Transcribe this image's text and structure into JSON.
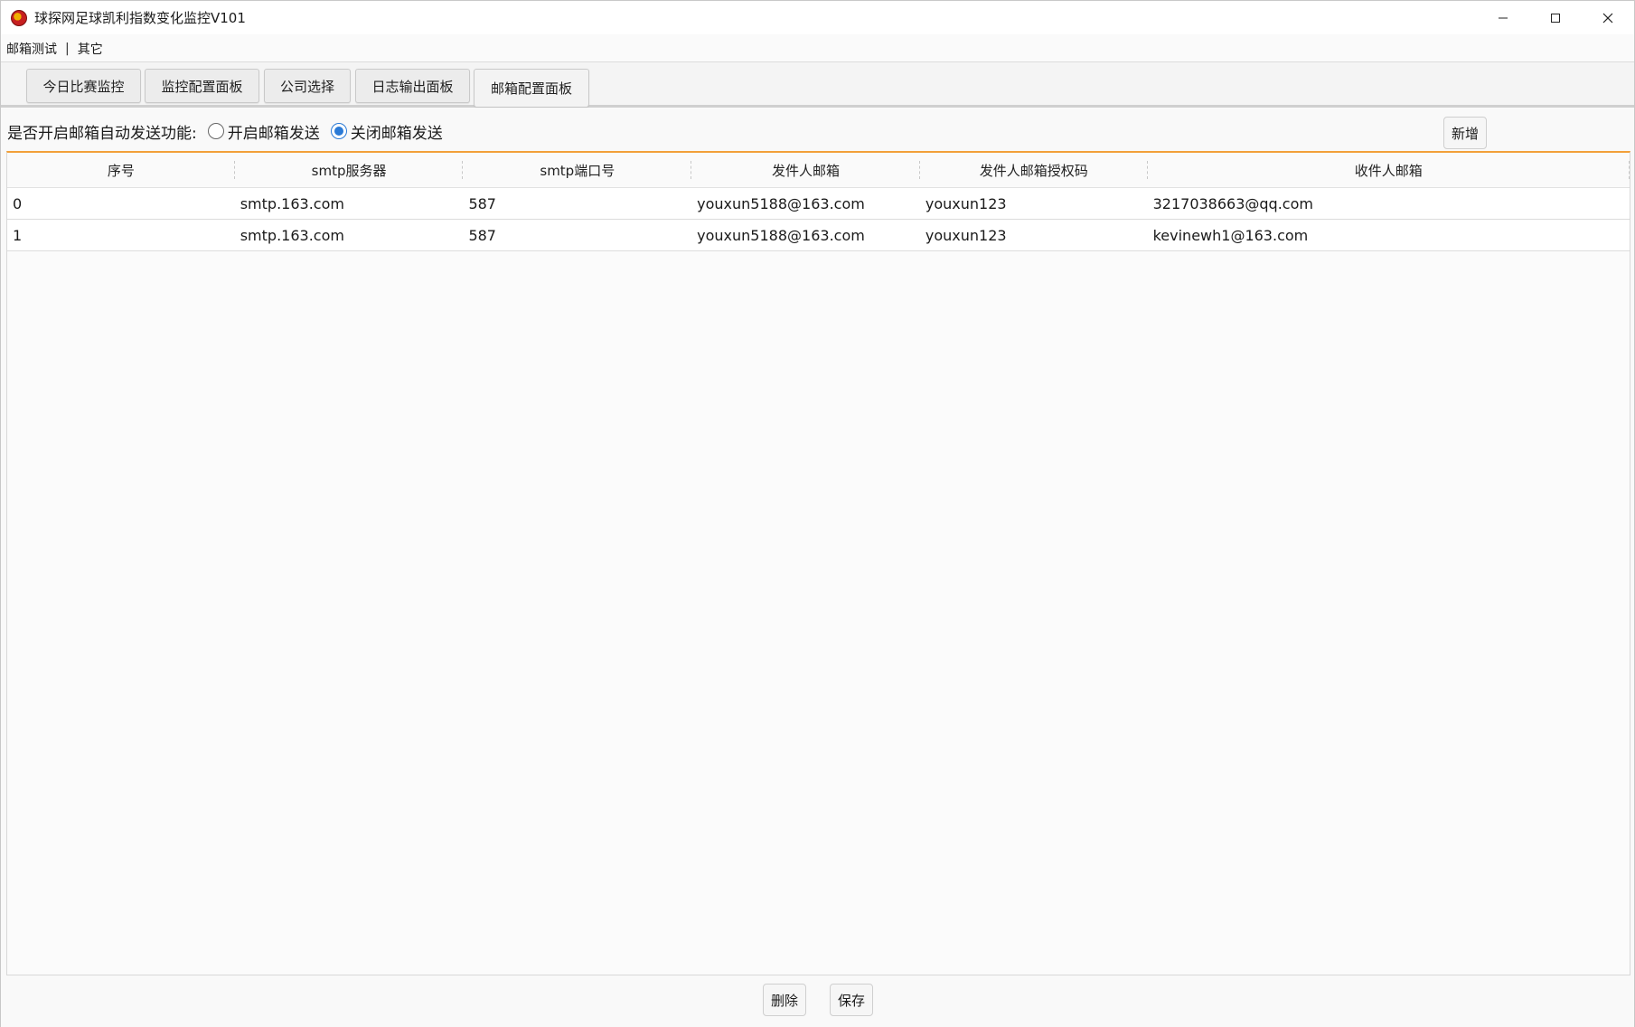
{
  "window": {
    "title": "球探网足球凯利指数变化监控V101",
    "icon": "app-logo-icon"
  },
  "menu": {
    "items": [
      "邮箱测试",
      "其它"
    ],
    "separator": "|"
  },
  "tabs": [
    {
      "label": "今日比赛监控",
      "active": false
    },
    {
      "label": "监控配置面板",
      "active": false
    },
    {
      "label": "公司选择",
      "active": false
    },
    {
      "label": "日志输出面板",
      "active": false
    },
    {
      "label": "邮箱配置面板",
      "active": true
    }
  ],
  "email_panel": {
    "question": "是否开启邮箱自动发送功能:",
    "options": [
      {
        "label": "开启邮箱发送",
        "checked": false
      },
      {
        "label": "关闭邮箱发送",
        "checked": true
      }
    ],
    "add_button": "新增",
    "delete_button": "删除",
    "save_button": "保存"
  },
  "table": {
    "columns": [
      "序号",
      "smtp服务器",
      "smtp端口号",
      "发件人邮箱",
      "发件人邮箱授权码",
      "收件人邮箱"
    ],
    "rows": [
      [
        "0",
        "smtp.163.com",
        "587",
        "youxun5188@163.com",
        "youxun123",
        "3217038663@qq.com"
      ],
      [
        "1",
        "smtp.163.com",
        "587",
        "youxun5188@163.com",
        "youxun123",
        "kevinewh1@163.com"
      ]
    ]
  },
  "colors": {
    "accent": "#f2a03a",
    "radio_checked": "#2a7ad6"
  }
}
